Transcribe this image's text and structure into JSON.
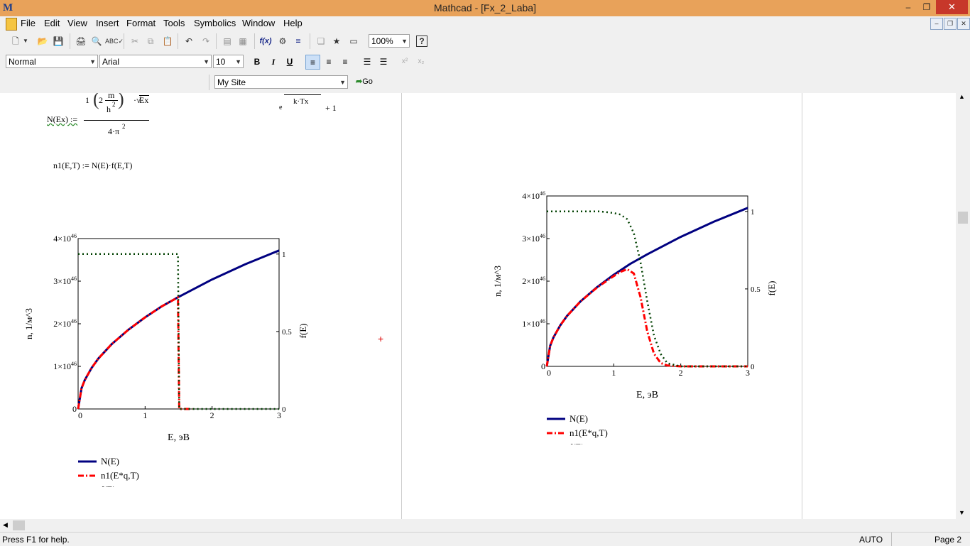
{
  "window": {
    "title": "Mathcad - [Fx_2_Laba]",
    "app_logo": "M",
    "minimize": "–",
    "maximize": "❐",
    "close": "✕"
  },
  "menu": [
    "File",
    "Edit",
    "View",
    "Insert",
    "Format",
    "Tools",
    "Symbolics",
    "Window",
    "Help"
  ],
  "toolbar": {
    "zoom": "100%",
    "style": "Normal",
    "font": "Arial",
    "size": "10",
    "url": "My Site",
    "go": "Go",
    "bold": "B",
    "italic": "I",
    "underline": "U"
  },
  "equations": {
    "n_def_lhs": "N(Ex) :=",
    "n_num_1": "1",
    "n_num_m": "m",
    "n_num_2": "2",
    "n_num_h": "h",
    "n_num_sq": "2",
    "n_num_sqrt": "Ex",
    "n_den": "4·π",
    "n_den_sq": "2",
    "f_den_e": "e",
    "f_den_kt": "k·Tx",
    "f_den_plus": "+ 1",
    "n1_def": "n1(E,T) := N(E)·f(E,T)"
  },
  "chart_data": [
    {
      "type": "line",
      "xlabel": "E, эB",
      "ylabel": "n, 1/м^3",
      "y2label": "f(E)",
      "xlim": [
        0,
        3
      ],
      "ylim": [
        0,
        4e+46
      ],
      "y2lim": [
        0,
        1.1
      ],
      "x_ticks": [
        "0",
        "1",
        "2",
        "3"
      ],
      "y_ticks": [
        {
          "v": 0,
          "label": "0"
        },
        {
          "v": 1,
          "label": "1×10",
          "exp": "46"
        },
        {
          "v": 2,
          "label": "2×10",
          "exp": "46"
        },
        {
          "v": 3,
          "label": "3×10",
          "exp": "46"
        },
        {
          "v": 4,
          "label": "4×10",
          "exp": "46"
        }
      ],
      "y2_ticks": [
        "0",
        "0.5",
        "1"
      ],
      "series": [
        {
          "name": "N(E)",
          "color": "#000080",
          "style": "solid",
          "axis": "left",
          "x": [
            0,
            0.05,
            0.1,
            0.2,
            0.3,
            0.5,
            0.75,
            1.0,
            1.25,
            1.5,
            2.0,
            2.5,
            3.0
          ],
          "y": [
            0,
            4.8e+45,
            6.8e+45,
            9.6e+45,
            1.18e+46,
            1.52e+46,
            1.86e+46,
            2.15e+46,
            2.41e+46,
            2.63e+46,
            3.04e+46,
            3.4e+46,
            3.72e+46
          ]
        },
        {
          "name": "n1(E*q,T)",
          "color": "#ff0000",
          "style": "dashdot",
          "axis": "left",
          "x": [
            0,
            0.05,
            0.1,
            0.2,
            0.3,
            0.5,
            0.75,
            1.0,
            1.25,
            1.49,
            1.5,
            1.51,
            1.7
          ],
          "y": [
            0,
            4.8e+45,
            6.8e+45,
            9.6e+45,
            1.18e+46,
            1.52e+46,
            1.86e+46,
            2.15e+46,
            2.41e+46,
            2.62e+46,
            1.31e+46,
            0.0,
            0.0
          ]
        },
        {
          "name": "f(E)",
          "color": "#004000",
          "style": "dotted",
          "axis": "right",
          "x": [
            0,
            1.49,
            1.5,
            1.51,
            3.0
          ],
          "y": [
            1.0,
            1.0,
            0.5,
            0.0,
            0.0
          ]
        }
      ],
      "legend": "bottom-left"
    },
    {
      "type": "line",
      "xlabel": "E, эB",
      "ylabel": "n, 1/м^3",
      "y2label": "f(E)",
      "xlim": [
        0,
        3
      ],
      "ylim": [
        0,
        4e+46
      ],
      "y2lim": [
        0,
        1.1
      ],
      "x_ticks": [
        "0",
        "1",
        "2",
        "3"
      ],
      "y_ticks": [
        {
          "v": 0,
          "label": "0"
        },
        {
          "v": 1,
          "label": "1×10",
          "exp": "46"
        },
        {
          "v": 2,
          "label": "2×10",
          "exp": "46"
        },
        {
          "v": 3,
          "label": "3×10",
          "exp": "46"
        },
        {
          "v": 4,
          "label": "4×10",
          "exp": "46"
        }
      ],
      "y2_ticks": [
        "0",
        "0.5",
        "1"
      ],
      "series": [
        {
          "name": "N(E)",
          "color": "#000080",
          "style": "solid",
          "axis": "left",
          "x": [
            0,
            0.05,
            0.1,
            0.2,
            0.3,
            0.5,
            0.75,
            1.0,
            1.25,
            1.5,
            2.0,
            2.5,
            3.0
          ],
          "y": [
            0,
            4.8e+45,
            6.8e+45,
            9.6e+45,
            1.18e+46,
            1.52e+46,
            1.86e+46,
            2.15e+46,
            2.41e+46,
            2.63e+46,
            3.04e+46,
            3.4e+46,
            3.72e+46
          ]
        },
        {
          "name": "n1(E*q,T)",
          "color": "#ff0000",
          "style": "dashdot",
          "axis": "left",
          "x": [
            0,
            0.05,
            0.1,
            0.2,
            0.3,
            0.5,
            0.75,
            1.0,
            1.1,
            1.2,
            1.3,
            1.4,
            1.5,
            1.6,
            1.7,
            1.8,
            2.0,
            2.5,
            3.0
          ],
          "y": [
            0,
            4.8e+45,
            6.8e+45,
            9.6e+45,
            1.18e+46,
            1.52e+46,
            1.85e+46,
            2.12e+46,
            2.22e+46,
            2.28e+46,
            2.18e+46,
            1.62e+46,
            8.2e+45,
            3e+45,
            8e+44,
            2e+44,
            0.0,
            0.0,
            0.0
          ]
        },
        {
          "name": "f(E)",
          "color": "#004000",
          "style": "dotted",
          "axis": "right",
          "x": [
            0,
            0.8,
            1.0,
            1.1,
            1.2,
            1.3,
            1.4,
            1.5,
            1.6,
            1.7,
            1.8,
            2.0,
            3.0
          ],
          "y": [
            1.0,
            1.0,
            0.99,
            0.98,
            0.95,
            0.86,
            0.67,
            0.42,
            0.2,
            0.08,
            0.02,
            0.0,
            0.0
          ]
        }
      ],
      "legend": "bottom-left"
    }
  ],
  "status": {
    "help": "Press F1 for help.",
    "mode": "AUTO",
    "page": "Page 2"
  }
}
